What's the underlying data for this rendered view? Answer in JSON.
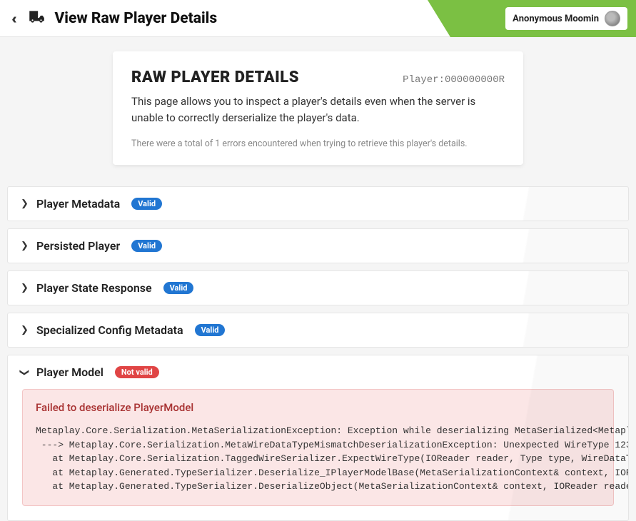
{
  "header": {
    "title": "View Raw Player Details",
    "user_label": "Anonymous Moomin"
  },
  "card": {
    "title": "RAW PLAYER DETAILS",
    "player_id": "Player:000000000R",
    "description": "This page allows you to inspect a player's details even when the server is unable to correctly derserialize the player's data.",
    "note": "There were a total of 1 errors encountered when trying to retrieve this player's details."
  },
  "panels": [
    {
      "title": "Player Metadata",
      "badge": "Valid",
      "valid": true,
      "expanded": false
    },
    {
      "title": "Persisted Player",
      "badge": "Valid",
      "valid": true,
      "expanded": false
    },
    {
      "title": "Player State Response",
      "badge": "Valid",
      "valid": true,
      "expanded": false
    },
    {
      "title": "Specialized Config Metadata",
      "badge": "Valid",
      "valid": true,
      "expanded": false
    },
    {
      "title": "Player Model",
      "badge": "Not valid",
      "valid": false,
      "expanded": true
    }
  ],
  "error": {
    "title": "Failed to deserialize PlayerModel",
    "stack": "Metaplay.Core.Serialization.MetaSerializationException: Exception while deserializing MetaSerialized<Metaplay.C\n ---> Metaplay.Core.Serialization.MetaWireDataTypeMismatchDeserializationException: Unexpected WireType 123 whe\n   at Metaplay.Core.Serialization.TaggedWireSerializer.ExpectWireType(IOReader reader, Type type, WireDataType\n   at Metaplay.Generated.TypeSerializer.Deserialize_IPlayerModelBase(MetaSerializationContext& context, IOReade\n   at Metaplay.Generated.TypeSerializer.DeserializeObject(MetaSerializationContext& context, IOReader reader, T"
  }
}
